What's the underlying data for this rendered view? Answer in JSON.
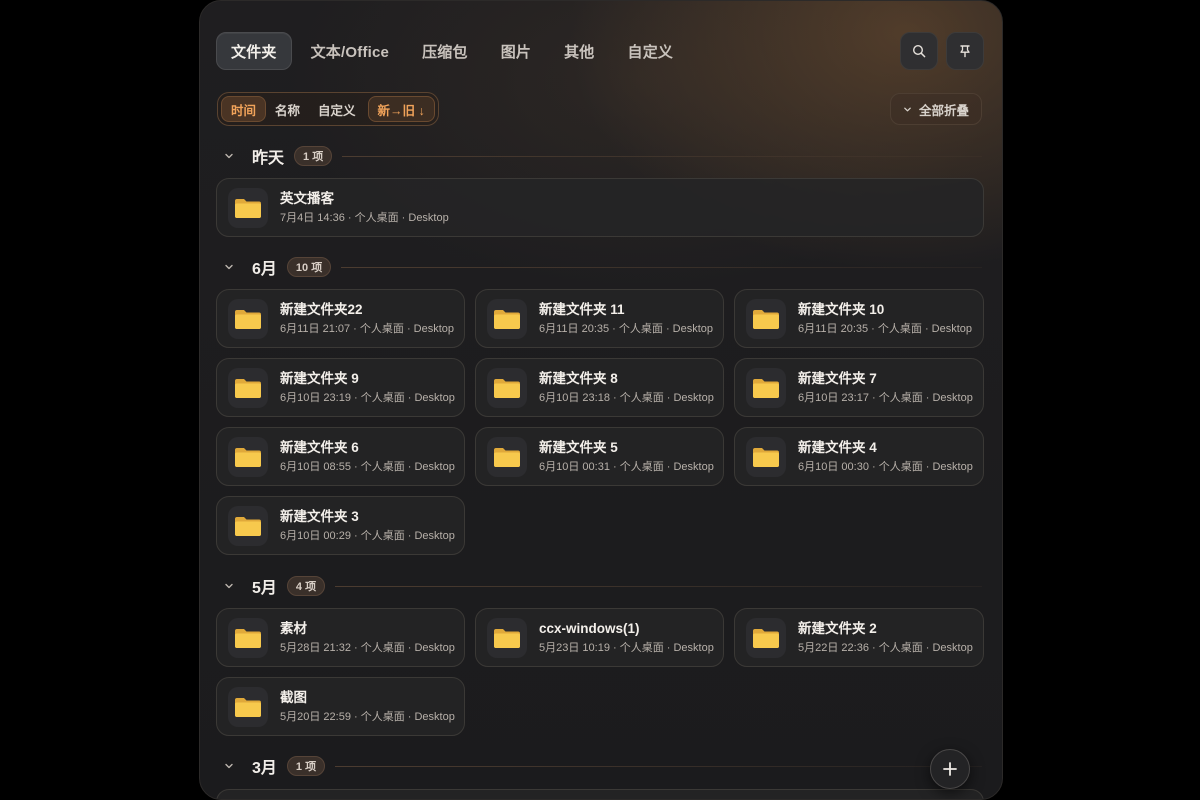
{
  "tabs": [
    "文件夹",
    "文本/Office",
    "压缩包",
    "图片",
    "其他",
    "自定义"
  ],
  "active_tab": "文件夹",
  "toolbar": {
    "search_icon": "search-icon",
    "pin_icon": "pin-icon"
  },
  "sort": {
    "time": "时间",
    "name": "名称",
    "custom": "自定义",
    "order": "新→旧 ↓"
  },
  "collapse_all": "全部折叠",
  "accent": "#f1a35a",
  "sections": [
    {
      "title": "昨天",
      "count": "1 项",
      "items": [
        {
          "name": "英文播客",
          "meta": "7月4日 14:36 · 个人桌面 · Desktop"
        }
      ]
    },
    {
      "title": "6月",
      "count": "10 项",
      "items": [
        {
          "name": "新建文件夹22",
          "meta": "6月11日 21:07 · 个人桌面 · Desktop"
        },
        {
          "name": "新建文件夹 11",
          "meta": "6月11日 20:35 · 个人桌面 · Desktop"
        },
        {
          "name": "新建文件夹 10",
          "meta": "6月11日 20:35 · 个人桌面 · Desktop"
        },
        {
          "name": "新建文件夹 9",
          "meta": "6月10日 23:19 · 个人桌面 · Desktop"
        },
        {
          "name": "新建文件夹 8",
          "meta": "6月10日 23:18 · 个人桌面 · Desktop"
        },
        {
          "name": "新建文件夹 7",
          "meta": "6月10日 23:17 · 个人桌面 · Desktop"
        },
        {
          "name": "新建文件夹 6",
          "meta": "6月10日 08:55 · 个人桌面 · Desktop"
        },
        {
          "name": "新建文件夹 5",
          "meta": "6月10日 00:31 · 个人桌面 · Desktop"
        },
        {
          "name": "新建文件夹 4",
          "meta": "6月10日 00:30 · 个人桌面 · Desktop"
        },
        {
          "name": "新建文件夹 3",
          "meta": "6月10日 00:29 · 个人桌面 · Desktop"
        }
      ]
    },
    {
      "title": "5月",
      "count": "4 项",
      "items": [
        {
          "name": "素材",
          "meta": "5月28日 21:32 · 个人桌面 · Desktop"
        },
        {
          "name": "ccx-windows(1)",
          "meta": "5月23日 10:19 · 个人桌面 · Desktop"
        },
        {
          "name": "新建文件夹 2",
          "meta": "5月22日 22:36 · 个人桌面 · Desktop"
        },
        {
          "name": "截图",
          "meta": "5月20日 22:59 · 个人桌面 · Desktop"
        }
      ]
    },
    {
      "title": "3月",
      "count": "1 项",
      "items": []
    }
  ],
  "fab_icon": "plus-icon"
}
